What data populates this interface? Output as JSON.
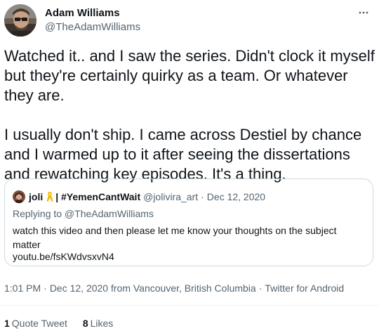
{
  "author": {
    "display_name": "Adam Williams",
    "handle": "@TheAdamWilliams",
    "avatar_icon": "profile-avatar"
  },
  "more_icon": "more-dots-icon",
  "tweet": {
    "paragraph_1": "Watched it.. and I saw the series. Didn't clock it myself but they're certainly quirky as a team. Or whatever they are.",
    "paragraph_2": "I usually don't ship. I came across Destiel by chance and I warmed up to it after seeing the dissertations and rewatching key episodes. It's a thing."
  },
  "quote": {
    "name": "joli",
    "ribbon_icon": "awareness-ribbon-icon",
    "name_rest": "| #YemenCantWait",
    "handle": "@jolivira_art",
    "dot": "·",
    "date": "Dec 12, 2020",
    "reply_to": "Replying to @TheAdamWilliams",
    "text": "watch this video and then please let me know your thoughts on the subject matter",
    "link": "youtu.be/fsKWdvsxvN4"
  },
  "meta": {
    "time": "1:01 PM",
    "date": "Dec 12, 2020 from Vancouver, British Columbia",
    "client": "Twitter for Android",
    "sep": "·"
  },
  "stats": {
    "quote_count": "1",
    "quote_label": "Quote Tweet",
    "like_count": "8",
    "like_label": "Likes"
  },
  "colors": {
    "text": "#0f1419",
    "secondary": "#536471",
    "border": "#cfd9de",
    "ribbon": "#f2b705"
  }
}
